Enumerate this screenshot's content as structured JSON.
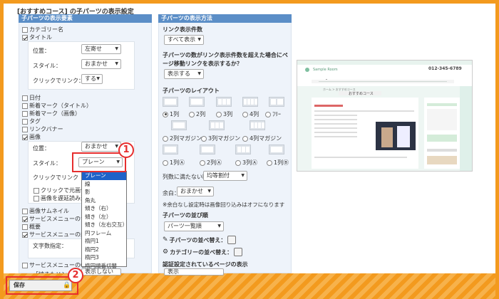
{
  "page": {
    "title": "[おすすめコース] の子パーツの表示設定"
  },
  "left": {
    "header": "子パーツの表示要素",
    "items": [
      {
        "label": "カテゴリー名",
        "checked": false
      },
      {
        "label": "タイトル",
        "checked": true
      },
      {
        "label": "日付",
        "checked": false
      },
      {
        "label": "新着マーク（タイトル）",
        "checked": false
      },
      {
        "label": "新着マーク（画像）",
        "checked": false
      },
      {
        "label": "タグ",
        "checked": false
      },
      {
        "label": "リンクバナー",
        "checked": false
      },
      {
        "label": "画像",
        "checked": true
      },
      {
        "label": "画像サムネイル",
        "checked": false
      },
      {
        "label": "サービスメニューのサ",
        "checked": true
      },
      {
        "label": "概要",
        "checked": false
      },
      {
        "label": "サービスメニューの内",
        "checked": true
      },
      {
        "label": "サービスメニューの〇",
        "checked": false
      }
    ],
    "title_box": {
      "position_label": "位置：",
      "position_value": "左寄せ",
      "style_label": "スタイル：",
      "style_value": "おまかせ",
      "click_label": "クリックでリンク：",
      "click_value": "する"
    },
    "image_box": {
      "position_label": "位置：",
      "position_value": "おまかせ",
      "style_label": "スタイル：",
      "style_value": "プレーン",
      "click_label": "クリックでリンク",
      "option1": "クリックで元画像を",
      "option2": "画像を遅延読み込み"
    },
    "text_count_label": "文字数指定：",
    "bottom_partial": "「続きもリンク」ターゲット",
    "bottom_select": "表示しない"
  },
  "dropdown": {
    "options": [
      "プレーン",
      "線",
      "影",
      "角丸",
      "傾き（右）",
      "傾き（左）",
      "傾き（左右交互）",
      "円フレーム",
      "楕円1",
      "楕円2",
      "楕円3",
      "楕円順番切替"
    ],
    "selected_index": 0
  },
  "middle": {
    "header": "子パーツの表示方法",
    "link_count_title": "リンク表示件数",
    "link_count_value": "すべて表示",
    "overflow_title": "子パーツの数がリンク表示件数を超えた場合にページ移動リンクを表示するか？",
    "overflow_value": "表示する",
    "layout_title": "子パーツのレイアウト",
    "layouts": [
      "1列",
      "2列",
      "3列",
      "4列",
      "ﾌﾘｰ",
      "2列マガジン",
      "3列マガジン",
      "4列マガジン",
      "1列Ⓐ",
      "2列Ⓐ",
      "3列Ⓐ",
      "1列Ⓑ"
    ],
    "selected_layout": 0,
    "uneven_label": "列数に満たない時：",
    "uneven_value": "均等割付",
    "margin_label": "余白：",
    "margin_value": "おまかせ",
    "margin_note": "※余白なし設定時は画像回り込みはオフになります",
    "order_title": "子パーツの並び順",
    "order_value": "パーツ一覧順",
    "sort_children": "子パーツの並べ替え：",
    "sort_categories": "カテゴリーの並べ替え：",
    "auth_title": "認証設定されているページの表示",
    "auth_value": "表示"
  },
  "preview": {
    "site_name": "Sample Room",
    "phone": "012-345-6789",
    "breadcrumb": "ホーム > おすすめコース",
    "section_title": "おすすめコース"
  },
  "footer": {
    "save_label": "保存",
    "badge1": "1",
    "badge2": "2"
  },
  "colors": {
    "header_bg": "#5b8ec7",
    "accent": "#f39a1e",
    "highlight": "#e62e2e",
    "dropdown_selected": "#1e62c8"
  }
}
